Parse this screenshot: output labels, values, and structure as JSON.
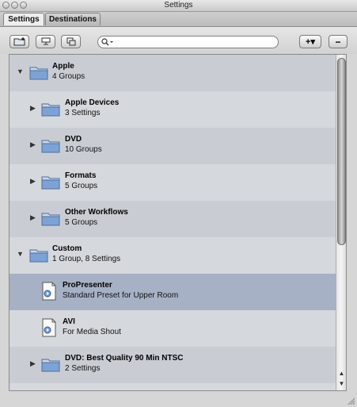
{
  "window": {
    "title": "Settings"
  },
  "tabs": [
    {
      "label": "Settings",
      "active": true
    },
    {
      "label": "Destinations",
      "active": false
    }
  ],
  "toolbar": {
    "buttons": [
      "new-folder-icon",
      "group-icon",
      "duplicate-icon"
    ],
    "search": {
      "value": "",
      "placeholder": ""
    },
    "add_label": "+▾",
    "remove_label": "−"
  },
  "list": {
    "rows": [
      {
        "name": "Apple",
        "sub": "4 Groups",
        "expanded": true,
        "level": 0,
        "icon": "folder-icon",
        "selected": false
      },
      {
        "name": "Apple Devices",
        "sub": "3 Settings",
        "expanded": false,
        "level": 1,
        "icon": "folder-icon",
        "selected": false
      },
      {
        "name": "DVD",
        "sub": "10 Groups",
        "expanded": false,
        "level": 1,
        "icon": "folder-icon",
        "selected": false
      },
      {
        "name": "Formats",
        "sub": "5 Groups",
        "expanded": false,
        "level": 1,
        "icon": "folder-icon",
        "selected": false
      },
      {
        "name": "Other Workflows",
        "sub": "5 Groups",
        "expanded": false,
        "level": 1,
        "icon": "folder-icon",
        "selected": false
      },
      {
        "name": "Custom",
        "sub": "1 Group, 8 Settings",
        "expanded": true,
        "level": 0,
        "icon": "folder-icon",
        "selected": false
      },
      {
        "name": "ProPresenter",
        "sub": "Standard Preset for Upper Room",
        "expanded": null,
        "level": 1,
        "icon": "setting-document-icon",
        "selected": true
      },
      {
        "name": "AVI",
        "sub": "For Media Shout",
        "expanded": null,
        "level": 1,
        "icon": "setting-document-icon",
        "selected": false
      },
      {
        "name": "DVD: Best Quality 90 Min NTSC",
        "sub": "2 Settings",
        "expanded": false,
        "level": 1,
        "icon": "folder-icon",
        "selected": false
      }
    ]
  },
  "colors": {
    "selection": "#a6b1c6",
    "folder": "#6f97cf"
  }
}
